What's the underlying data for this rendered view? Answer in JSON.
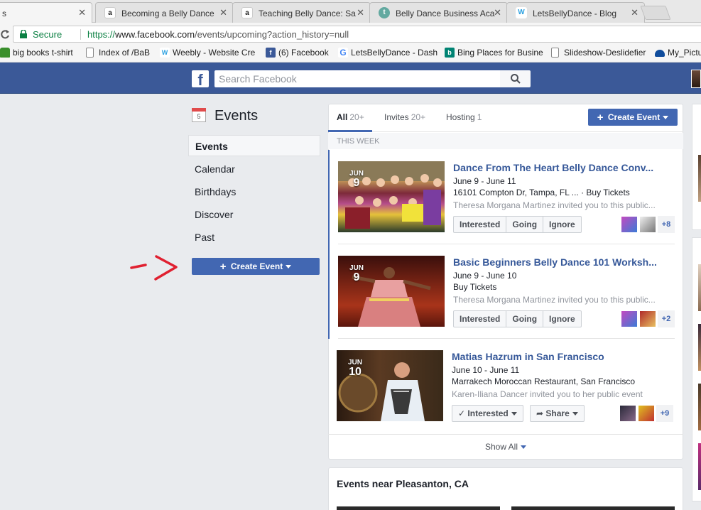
{
  "browser": {
    "tabs": [
      {
        "label": "s",
        "favicon": "",
        "active": true
      },
      {
        "label": "Becoming a Belly Dance",
        "favicon": "a",
        "fav_color": "#222"
      },
      {
        "label": "Teaching Belly Dance: Sa",
        "favicon": "a",
        "fav_color": "#222"
      },
      {
        "label": "Belly Dance Business Aca",
        "favicon": "t",
        "fav_color": "#62a9a0"
      },
      {
        "label": "LetsBellyDance - Blog",
        "favicon": "W",
        "fav_color": "#2aa0e0"
      }
    ],
    "close_glyph": "✕",
    "security_label": "Secure",
    "url_scheme": "https://",
    "url_host": "www.facebook.com",
    "url_path": "/events/upcoming?action_history=null",
    "bookmarks": [
      {
        "label": "big books t-shirt",
        "icon": "shirt-icon",
        "color": "#3a8f2c"
      },
      {
        "label": "Index of /BaB",
        "icon": "page-icon",
        "color": "#888"
      },
      {
        "label": "Weebly - Website Cre",
        "icon": "weebly-icon",
        "color": "#2aa0e0",
        "glyph": "W"
      },
      {
        "label": "(6) Facebook",
        "icon": "facebook-icon",
        "color": "#3b5998",
        "glyph": "f"
      },
      {
        "label": "LetsBellyDance - Dash",
        "icon": "google-icon",
        "color": "#4285f4",
        "glyph": "G"
      },
      {
        "label": "Bing Places for Busine",
        "icon": "bing-icon",
        "color": "#008373",
        "glyph": "b"
      },
      {
        "label": "Slideshow-Deslidefier",
        "icon": "page-icon",
        "color": "#888"
      },
      {
        "label": "My_Pictu",
        "icon": "onedrive-icon",
        "color": "#0f4c9c"
      }
    ]
  },
  "fb": {
    "logo": "f",
    "search_placeholder": "Search Facebook"
  },
  "nav": {
    "title": "Events",
    "calendar_day": "5",
    "items": [
      "Events",
      "Calendar",
      "Birthdays",
      "Discover",
      "Past"
    ],
    "create_label": "Create Event"
  },
  "main": {
    "filters": [
      {
        "label": "All",
        "count": "20+"
      },
      {
        "label": "Invites",
        "count": "20+"
      },
      {
        "label": "Hosting",
        "count": "1"
      }
    ],
    "create_label": "Create Event",
    "section": "THIS WEEK",
    "events": [
      {
        "month": "JUN",
        "day": "9",
        "title": "Dance From The Heart Belly Dance Conv...",
        "dates": "June 9 - June 11",
        "location": "16101 Compton Dr, Tampa, FL ... · Buy Tickets",
        "invite": "Theresa Morgana Martinez invited you to this public...",
        "actions": [
          "Interested",
          "Going",
          "Ignore"
        ],
        "more_friends": "+8"
      },
      {
        "month": "JUN",
        "day": "9",
        "title": "Basic Beginners Belly Dance 101 Worksh...",
        "dates": "June 9 - June 10",
        "location": "Buy Tickets",
        "invite": "Theresa Morgana Martinez invited you to this public...",
        "actions": [
          "Interested",
          "Going",
          "Ignore"
        ],
        "more_friends": "+2"
      },
      {
        "month": "JUN",
        "day": "10",
        "title": "Matias Hazrum in San Francisco",
        "dates": "June 10 - June 11",
        "location": "Marrakech Moroccan Restaurant, San Francisco",
        "invite": "Karen-Iliana Dancer invited you to her public event",
        "interested_label": "Interested",
        "share_label": "Share",
        "more_friends": "+9"
      }
    ],
    "show_all": "Show All",
    "near_title": "Events near Pleasanton, CA"
  },
  "colors": {
    "fb_blue": "#3b5998",
    "button_blue": "#4267b2",
    "link_blue": "#365899",
    "annotation_red": "#e02030"
  }
}
